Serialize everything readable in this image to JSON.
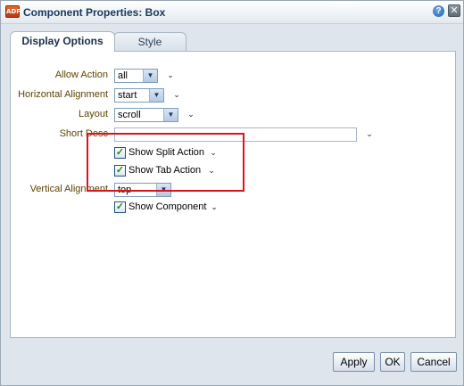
{
  "window": {
    "title": "Component Properties: Box",
    "app_icon_text": "ADF"
  },
  "tabs": [
    {
      "label": "Display Options",
      "selected": true
    },
    {
      "label": "Style",
      "selected": false
    }
  ],
  "form": {
    "allow_action": {
      "label": "Allow Action",
      "value": "all"
    },
    "horizontal_alignment": {
      "label": "Horizontal Alignment",
      "value": "start"
    },
    "layout": {
      "label": "Layout",
      "value": "scroll"
    },
    "short_desc": {
      "label": "Short Desc",
      "value": ""
    },
    "show_split_action": {
      "label": "Show Split Action",
      "checked": true
    },
    "show_tab_action": {
      "label": "Show Tab Action",
      "checked": true
    },
    "vertical_alignment": {
      "label": "Vertical Alignment",
      "value": "top"
    },
    "show_component": {
      "label": "Show Component",
      "checked": true
    }
  },
  "buttons": {
    "apply": "Apply",
    "ok": "OK",
    "cancel": "Cancel"
  },
  "icons": {
    "help": "?",
    "close": "✕",
    "chevron": "⌄",
    "dropdown_arrow": "▼",
    "check": "✓"
  },
  "colors": {
    "label_text": "#5b4400",
    "highlight_box": "#d8141c",
    "title_text": "#17365d"
  }
}
